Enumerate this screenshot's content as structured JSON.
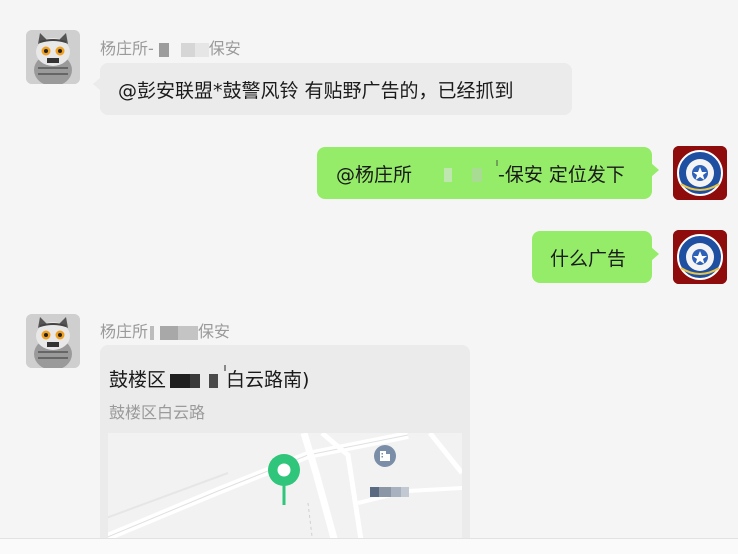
{
  "messages": [
    {
      "sender_prefix": "杨庄所-",
      "sender_suffix": "保安",
      "text": "@彭安联盟*鼓警风铃 有贴野广告的，已经抓到"
    },
    {
      "text_prefix": "@杨庄所",
      "text_suffix": "-保安 定位发下"
    },
    {
      "text": "什么广告"
    },
    {
      "sender_prefix": "杨庄所",
      "sender_suffix": "保安",
      "location": {
        "name_prefix": "鼓楼区",
        "name_suffix": "白云路南)",
        "address": "鼓楼区白云路"
      }
    }
  ],
  "colors": {
    "outgoing_bubble": "#95ec69",
    "incoming_bubble": "#ebebeb",
    "map_pin": "#2fc57a",
    "background": "#f5f5f5"
  },
  "icons": [
    "cat-avatar",
    "police-badge-avatar",
    "location-pin-icon",
    "building-icon"
  ]
}
